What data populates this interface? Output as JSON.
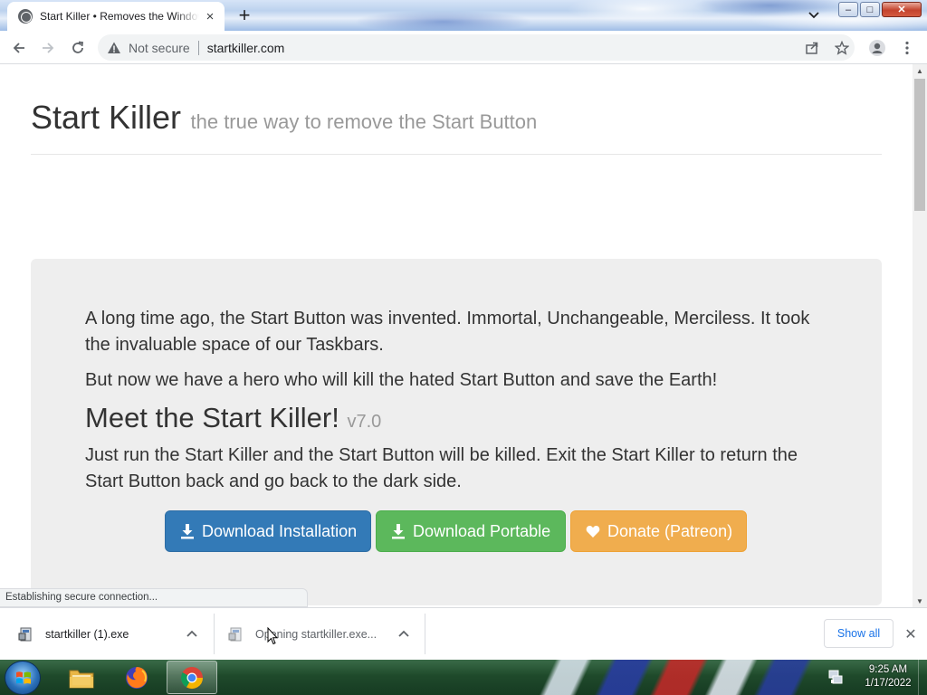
{
  "browser": {
    "tab": {
      "title": "Start Killer • Removes the Windows Start Button",
      "close_glyph": "×"
    },
    "new_tab_glyph": "+",
    "window_controls": {
      "minimize": "–",
      "maximize": "□",
      "close": "✕"
    },
    "address_bar": {
      "security_label": "Not secure",
      "url": "startkiller.com"
    },
    "icons": {
      "back": "back-arrow-icon",
      "forward": "forward-arrow-icon",
      "reload": "reload-icon",
      "warning": "warning-triangle-icon",
      "share": "share-icon",
      "bookmark": "star-icon",
      "profile": "profile-icon",
      "menu": "kebab-menu-icon",
      "tab_search": "chevron-down-icon"
    },
    "status_bubble": "Establishing secure connection..."
  },
  "page": {
    "header": {
      "name": "Start Killer",
      "tagline": "the true way to remove the Start Button"
    },
    "jumbotron": {
      "intro": "A long time ago, the Start Button was invented. Immortal, Unchangeable, Merciless. It took the invaluable space of our Taskbars.",
      "hero": "But now we have a hero who will kill the hated Start Button and save the Earth!",
      "heading": "Meet the Start Killer!",
      "version": "v7.0",
      "instructions": "Just run the Start Killer and the Start Button will be killed. Exit the Start Killer to return the Start Button back and go back to the dark side."
    },
    "buttons": {
      "download_installation": "Download Installation",
      "download_portable": "Download Portable",
      "donate": "Donate (Patreon)"
    },
    "colors": {
      "primary": "#337ab7",
      "success": "#5cb85c",
      "warning": "#f0ad4e"
    }
  },
  "download_shelf": {
    "items": [
      {
        "filename": "startkiller (1).exe"
      },
      {
        "filename": "Opening startkiller.exe..."
      }
    ],
    "show_all": "Show all",
    "close_glyph": "✕"
  },
  "taskbar": {
    "pinned": [
      "windows-explorer",
      "firefox",
      "chrome"
    ],
    "active": "chrome",
    "clock": {
      "time": "9:25 AM",
      "date": "1/17/2022"
    }
  }
}
